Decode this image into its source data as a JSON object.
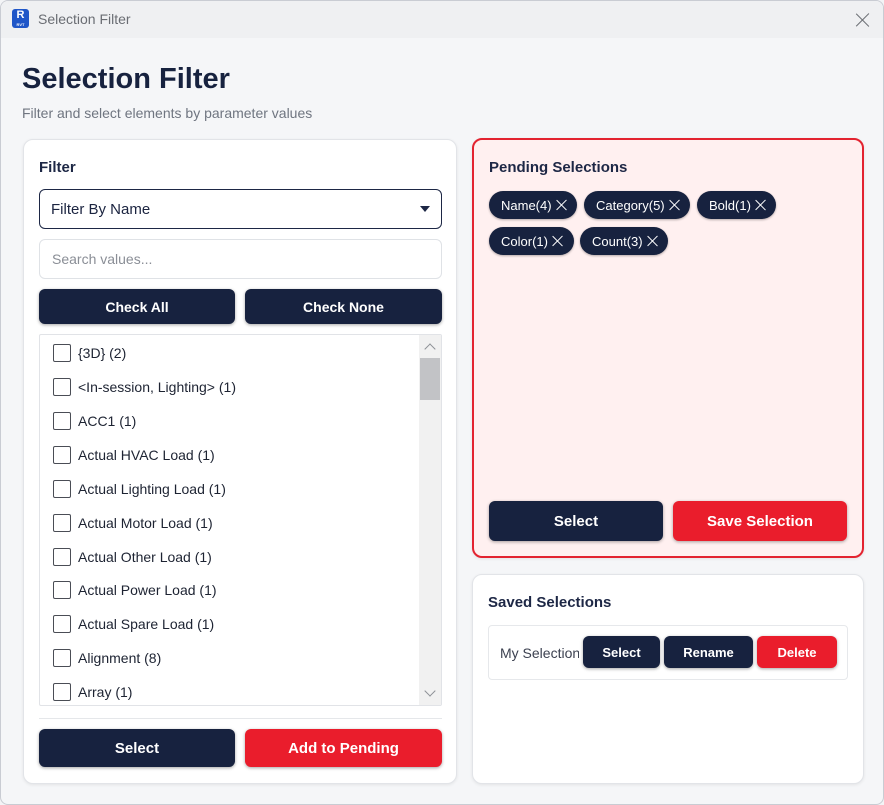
{
  "window": {
    "icon_letter": "R",
    "icon_sub": "RVT",
    "title": "Selection Filter"
  },
  "header": {
    "title": "Selection Filter",
    "subtitle": "Filter and select elements by parameter values"
  },
  "filter": {
    "heading": "Filter",
    "dropdown_value": "Filter By Name",
    "search_placeholder": "Search values...",
    "check_all_label": "Check All",
    "check_none_label": "Check None",
    "items": [
      {
        "label": "{3D} (2)",
        "checked": false
      },
      {
        "label": "<In-session, Lighting> (1)",
        "checked": false
      },
      {
        "label": "ACC1 (1)",
        "checked": false
      },
      {
        "label": "Actual HVAC Load (1)",
        "checked": false
      },
      {
        "label": "Actual Lighting Load (1)",
        "checked": false
      },
      {
        "label": "Actual Motor Load (1)",
        "checked": false
      },
      {
        "label": "Actual Other Load (1)",
        "checked": false
      },
      {
        "label": "Actual Power Load (1)",
        "checked": false
      },
      {
        "label": "Actual Spare Load (1)",
        "checked": false
      },
      {
        "label": "Alignment (8)",
        "checked": false
      },
      {
        "label": "Array (1)",
        "checked": false
      }
    ],
    "select_label": "Select",
    "add_pending_label": "Add to Pending"
  },
  "pending": {
    "heading": "Pending Selections",
    "chips": [
      "Name(4)",
      "Category(5)",
      "Bold(1)",
      "Color(1)",
      "Count(3)"
    ],
    "select_label": "Select",
    "save_label": "Save Selection"
  },
  "saved": {
    "heading": "Saved Selections",
    "items": [
      {
        "name": "My Selection",
        "select_label": "Select",
        "rename_label": "Rename",
        "delete_label": "Delete"
      }
    ]
  },
  "colors": {
    "navy": "#17223f",
    "red": "#ea1d2c",
    "pending_bg": "#fff0f0",
    "app_icon": "#1f56c8"
  }
}
